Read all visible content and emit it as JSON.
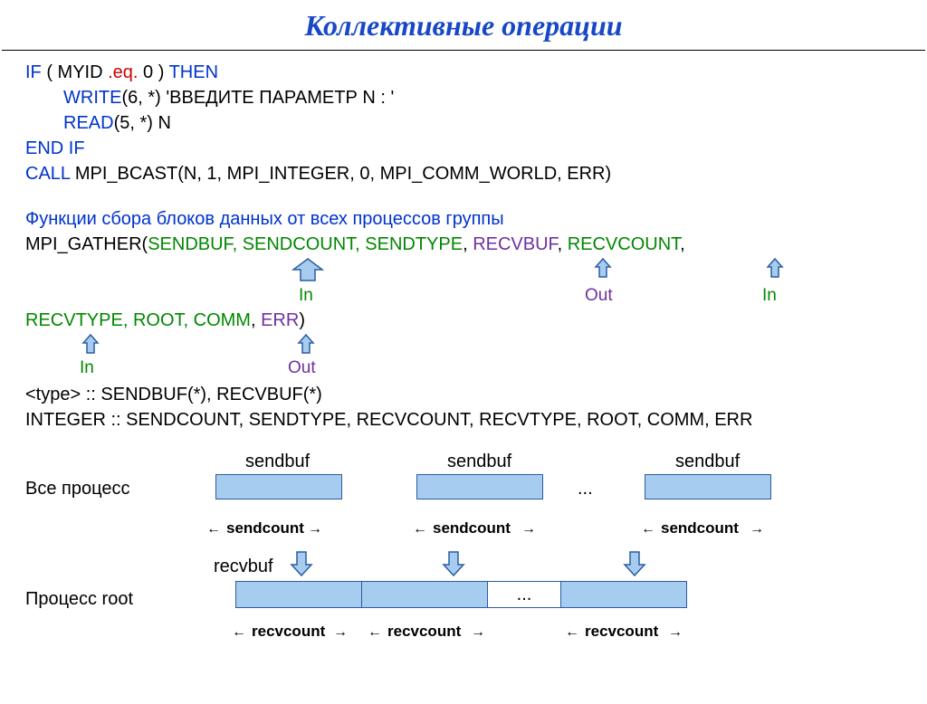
{
  "title": "Коллективные операции",
  "code": {
    "if_kw": "IF",
    "myid": " ( MYID ",
    "eq": ".eq.",
    "zero_then": " 0 ) ",
    "then_kw": "THEN",
    "write_kw": "WRITE",
    "write_args": "(6, *) 'ВВЕДИТЕ ПАРАМЕТР N : '",
    "read_kw": "READ",
    "read_args": "(5, *) N",
    "endif_kw": "END IF",
    "call_kw": "CALL",
    "bcast": " MPI_BCAST(N, 1, MPI_INTEGER, 0, MPI_COMM_WORLD, ERR)"
  },
  "gather_caption": "Функции сбора блоков данных от всех процессов группы",
  "gather": {
    "fn": "MPI_GATHER(",
    "sendbuf": "SENDBUF",
    "sendcount": "SENDCOUNT",
    "sendtype": "SENDTYPE",
    "recvbuf": "RECVBUF",
    "recvcount": "RECVCOUNT",
    "recvtype": "RECVTYPE",
    "root": "ROOT",
    "comm": "COMM",
    "err": "ERR",
    "sep": ", ",
    "close": ")"
  },
  "labels": {
    "in": "In",
    "out": "Out"
  },
  "decl1": "<type> :: SENDBUF(*), RECVBUF(*)",
  "decl2": "INTEGER :: SENDCOUNT, SENDTYPE, RECVCOUNT, RECVTYPE, ROOT, COMM, ERR",
  "diagram": {
    "all_proc": "Все процесс",
    "root_proc": "Процесс root",
    "sendbuf": "sendbuf",
    "recvbuf": "recvbuf",
    "sendcount": "sendcount",
    "recvcount": "recvcount",
    "dots": "..."
  }
}
